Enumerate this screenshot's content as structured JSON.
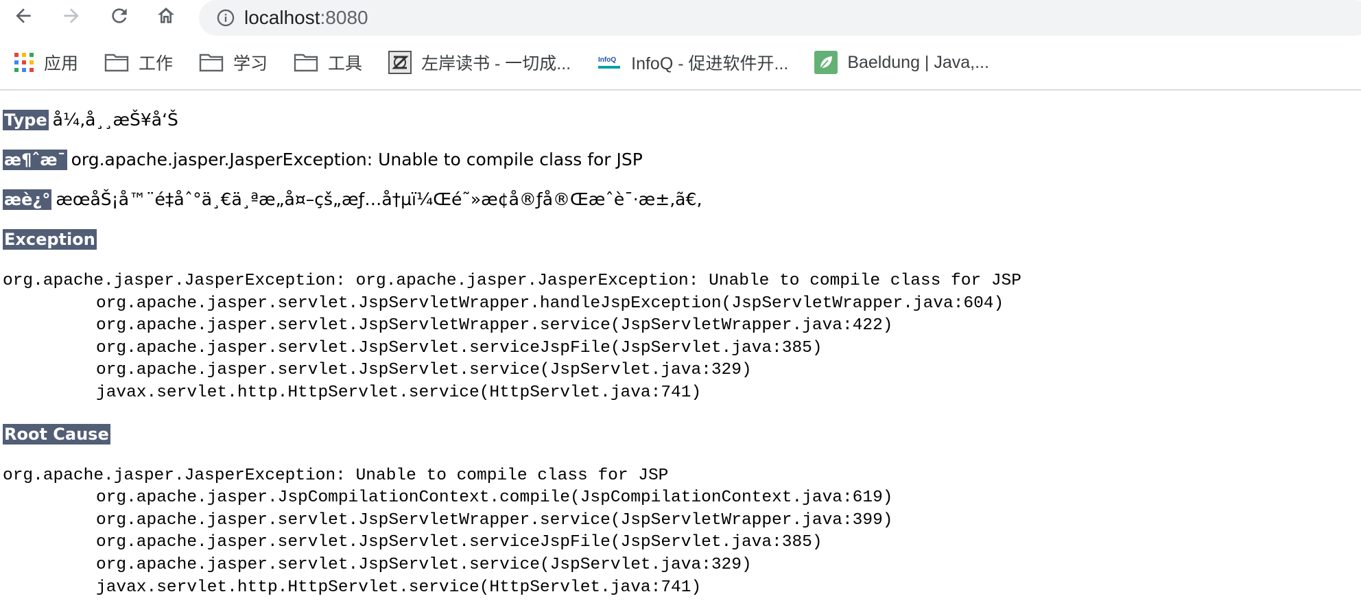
{
  "browser": {
    "url_host": "localhost",
    "url_port": ":8080",
    "icons": {
      "back": "arrow-left-icon",
      "forward": "arrow-right-icon",
      "reload": "reload-icon",
      "home": "home-icon",
      "info": "info-circle-icon"
    }
  },
  "bookmarks": [
    {
      "label": "应用",
      "icon": "apps-grid-icon"
    },
    {
      "label": "工作",
      "icon": "folder-icon"
    },
    {
      "label": "学习",
      "icon": "folder-icon"
    },
    {
      "label": "工具",
      "icon": "folder-icon"
    },
    {
      "label": "左岸读书 - 一切成...",
      "icon": "zuoan-logo-icon"
    },
    {
      "label": "InfoQ - 促进软件开...",
      "icon": "infoq-logo-icon"
    },
    {
      "label": "Baeldung | Java,...",
      "icon": "baeldung-leaf-icon"
    }
  ],
  "error_page": {
    "type_label": "Type",
    "type_value": "å¼‚å¸¸æŠ¥å‘Š",
    "message_label": "æ¶ˆæ¯",
    "message_value": "org.apache.jasper.JasperException: Unable to compile class for JSP",
    "description_label": "æè¿°",
    "description_value": "æœåŠ¡å™¨é‡åˆ°ä¸€ä¸ªæ„å¤–çš„æƒ…å†µï¼Œé˜»æ­¢å®ƒå®Œæˆè¯·æ±‚ã€‚",
    "exception_label": "Exception",
    "exception_trace": [
      "org.apache.jasper.JasperException: org.apache.jasper.JasperException: Unable to compile class for JSP",
      "org.apache.jasper.servlet.JspServletWrapper.handleJspException(JspServletWrapper.java:604)",
      "org.apache.jasper.servlet.JspServletWrapper.service(JspServletWrapper.java:422)",
      "org.apache.jasper.servlet.JspServlet.serviceJspFile(JspServlet.java:385)",
      "org.apache.jasper.servlet.JspServlet.service(JspServlet.java:329)",
      "javax.servlet.http.HttpServlet.service(HttpServlet.java:741)"
    ],
    "root_cause_label": "Root Cause",
    "root_cause_trace": [
      "org.apache.jasper.JasperException: Unable to compile class for JSP",
      "org.apache.jasper.JspCompilationContext.compile(JspCompilationContext.java:619)",
      "org.apache.jasper.servlet.JspServletWrapper.service(JspServletWrapper.java:399)",
      "org.apache.jasper.servlet.JspServlet.serviceJspFile(JspServlet.java:385)",
      "org.apache.jasper.servlet.JspServlet.service(JspServlet.java:329)",
      "javax.servlet.http.HttpServlet.service(HttpServlet.java:741)"
    ]
  },
  "colors": {
    "header_bg": "#525d76",
    "omnibox_bg": "#f1f3f4",
    "icon_gray": "#5f6368",
    "disabled_gray": "#bdc1c6"
  }
}
